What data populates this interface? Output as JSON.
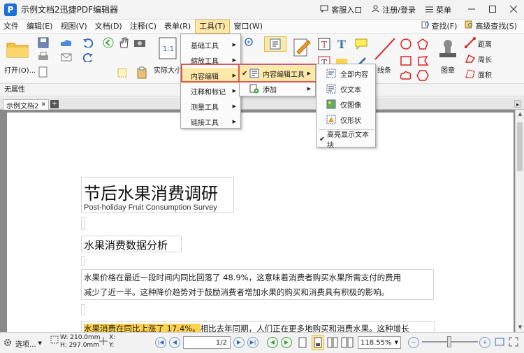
{
  "window": {
    "title": "示例文档2迅捷PDF编辑器",
    "customer": "客服入口",
    "login": "注册/登录",
    "menu": "菜单"
  },
  "menubar": {
    "items": [
      "文件",
      "编辑(E)",
      "视图(V)",
      "文档(D)",
      "注释(C)",
      "表单(R)",
      "工具(T)",
      "窗口(W)"
    ],
    "active_index": 6,
    "find": "查找(F)",
    "advanced_find": "高级查找(S)"
  },
  "ribbon": {
    "open": "打开(O)...",
    "actual_size": "实际大小",
    "stamp": "图章",
    "distance": "距离",
    "perimeter": "周长",
    "area": "面积",
    "lines": "线条"
  },
  "propbar": {
    "label": "无属性"
  },
  "tab": {
    "name": "示例文档2"
  },
  "tools_menu": {
    "items": [
      "基础工具",
      "缩放工具",
      "内容编辑",
      "注释和标记",
      "测量工具",
      "链接工具"
    ],
    "selected_index": 2
  },
  "content_edit_menu": {
    "items": [
      "内容编辑工具",
      "添加"
    ],
    "selected_index": 0
  },
  "content_tool_menu": {
    "items": [
      "全部内容",
      "仅文本",
      "仅图像",
      "仅形状"
    ],
    "highlight": "高亮显示文本块"
  },
  "document": {
    "title": "节后水果消费调研",
    "subtitle": "Post-holiday Fruit Consumption Survey",
    "section": "水果消费数据分析",
    "para1_line1": "水果价格在最近一段时间内同比回落了 48.9%，这意味着消费者购买水果所需支付的费用",
    "para1_line2": "减少了近一半。这种降价趋势对于鼓励消费者增加水果的购买和消费具有积极的影响。",
    "para2_highlight": "水果消费在同比上涨了 17.4%。",
    "para2_rest": "相比去年同期，人们正在更多地购买和消费水果。这种增长"
  },
  "status": {
    "select": "选项...",
    "width": "W: 210.0mm",
    "height": "H: 297.0mm",
    "x": "X:",
    "y": "Y:",
    "page": "1",
    "total": "/2",
    "zoom": "118.55%"
  },
  "colors": {
    "accent": "#ffe9a8",
    "highlight": "#ffd24d",
    "frame": "#e25555",
    "brand": "#1d6fd6"
  }
}
